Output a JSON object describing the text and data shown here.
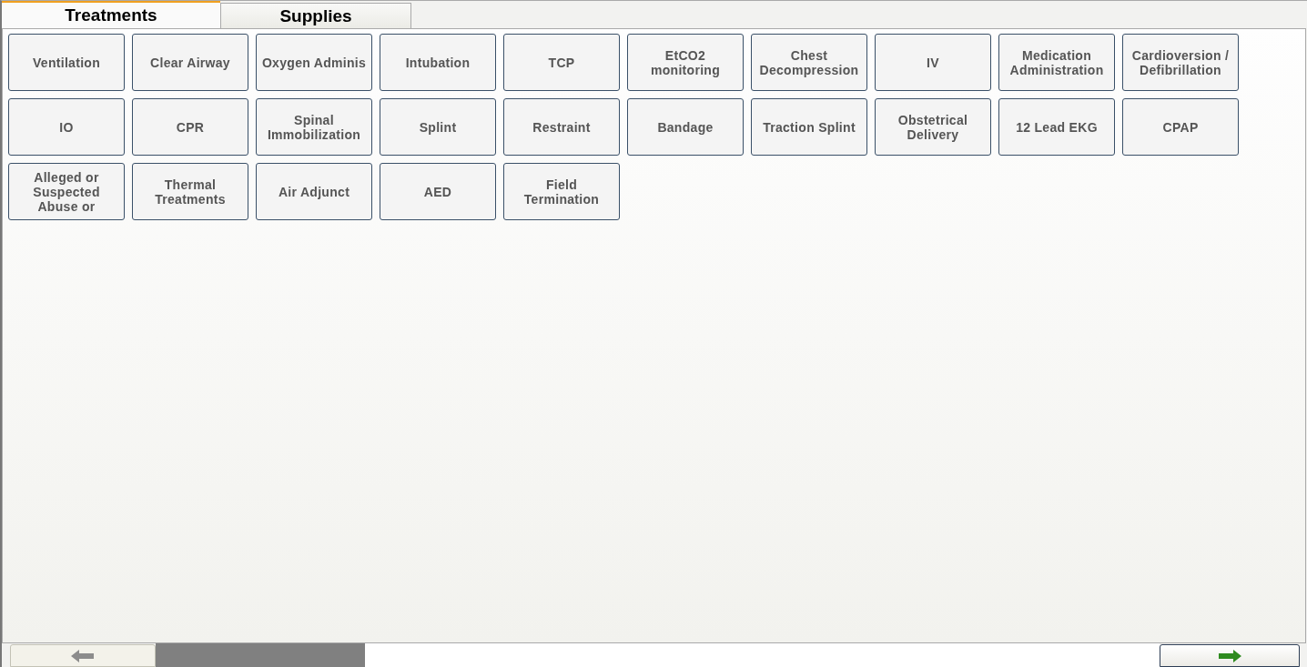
{
  "tabs": [
    {
      "label": "Treatments",
      "selected": true
    },
    {
      "label": "Supplies",
      "selected": false
    }
  ],
  "treatments": [
    "Ventilation",
    "Clear Airway",
    "Oxygen Adminis",
    "Intubation",
    "TCP",
    "EtCO2 monitoring",
    "Chest Decompression",
    "IV",
    "Medication Administration",
    "Cardioversion / Defibrillation",
    "IO",
    "CPR",
    "Spinal Immobilization",
    "Splint",
    "Restraint",
    "Bandage",
    "Traction Splint",
    "Obstetrical Delivery",
    "12 Lead EKG",
    "CPAP",
    "Alleged or Suspected Abuse or",
    "Thermal Treatments",
    "Air Adjunct",
    "AED",
    "Field Termination"
  ],
  "nav": [
    {
      "kind": "back",
      "disabled": true
    },
    {
      "kind": "next",
      "disabled": false
    }
  ]
}
